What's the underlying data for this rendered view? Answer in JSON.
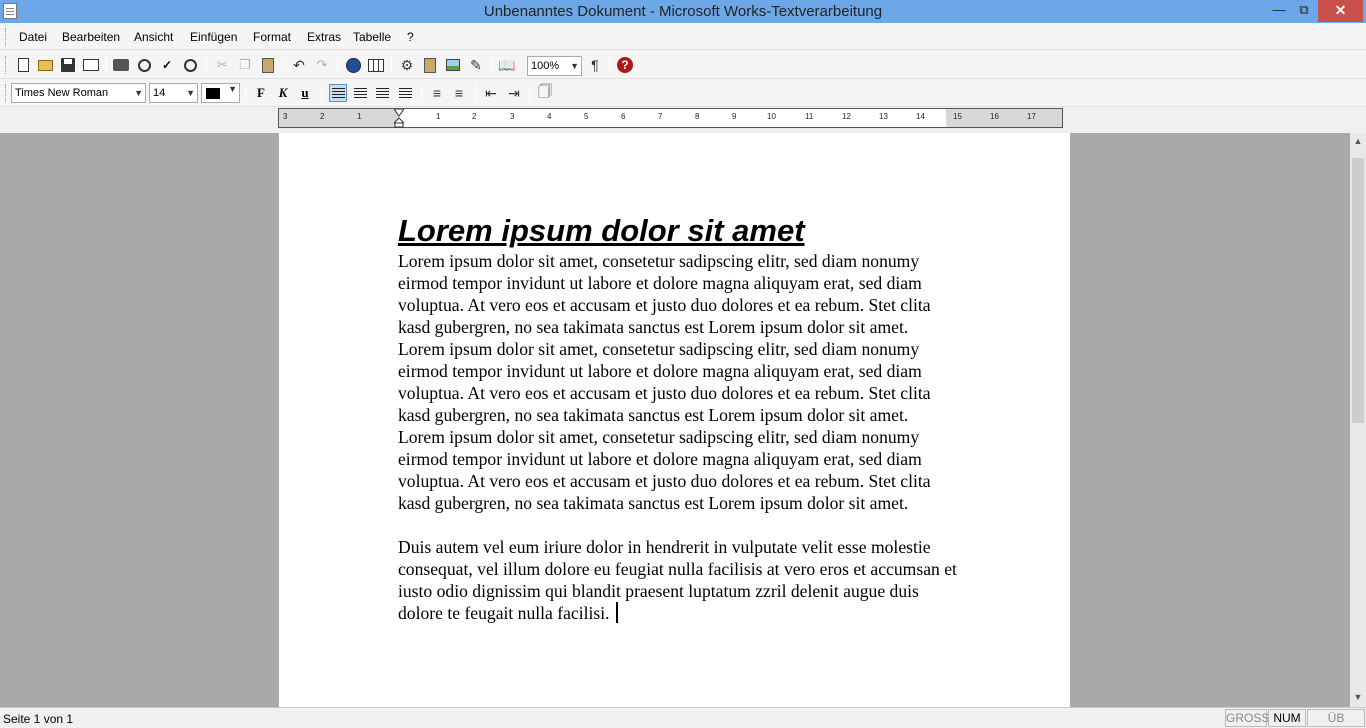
{
  "window": {
    "title": "Unbenanntes Dokument - Microsoft Works-Textverarbeitung"
  },
  "menu": [
    "Datei",
    "Bearbeiten",
    "Ansicht",
    "Einfügen",
    "Format",
    "Extras",
    "Tabelle",
    "?"
  ],
  "toolbar": {
    "zoom": "100%",
    "paragraph_mark": "¶",
    "help": "?"
  },
  "format_bar": {
    "font": "Times New Roman",
    "size": "14",
    "color": "#000000",
    "bold": "F",
    "italic": "K",
    "underline": "u"
  },
  "ruler": {
    "numbers": [
      "3",
      "2",
      "1",
      "1",
      "2",
      "3",
      "4",
      "5",
      "6",
      "7",
      "8",
      "9",
      "10",
      "11",
      "12",
      "13",
      "14",
      "15",
      "16",
      "17"
    ]
  },
  "document": {
    "heading": "Lorem ipsum dolor sit amet",
    "paragraphs": [
      "Lorem ipsum dolor sit amet, consetetur sadipscing elitr, sed diam nonumy eirmod tempor invidunt ut labore et dolore magna aliquyam erat, sed diam voluptua. At vero eos et accusam et justo duo dolores et ea rebum. Stet clita kasd gubergren, no sea takimata sanctus est Lorem ipsum dolor sit amet. Lorem ipsum dolor sit amet, consetetur sadipscing elitr, sed diam nonumy eirmod tempor invidunt ut labore et dolore magna aliquyam erat, sed diam voluptua. At vero eos et accusam et justo duo dolores et ea rebum. Stet clita kasd gubergren, no sea takimata sanctus est Lorem ipsum dolor sit amet. Lorem ipsum dolor sit amet, consetetur sadipscing elitr, sed diam nonumy eirmod tempor invidunt ut labore et dolore magna aliquyam erat, sed diam voluptua. At vero eos et accusam et justo duo dolores et ea rebum. Stet clita kasd gubergren, no sea takimata sanctus est Lorem ipsum dolor sit amet.",
      "Duis autem vel eum iriure dolor in hendrerit in vulputate velit esse molestie consequat, vel illum dolore eu feugiat nulla facilisis at vero eros et accumsan et iusto odio dignissim qui blandit praesent luptatum zzril delenit augue duis dolore te feugait nulla facilisi."
    ]
  },
  "status": {
    "page": "Seite 1 von 1",
    "caps": "GROSS",
    "num": "NUM",
    "overtype": "ÜB"
  }
}
